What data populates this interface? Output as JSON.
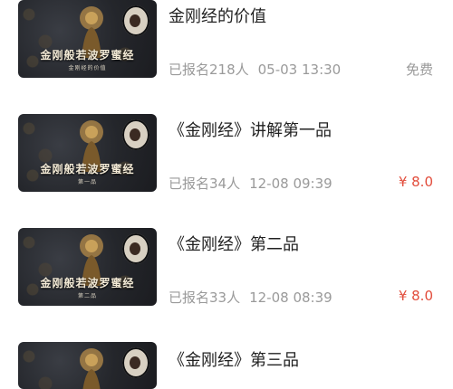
{
  "courses": [
    {
      "thumb_title": "金刚般若波罗蜜经",
      "thumb_subtitle": "金刚经的价值",
      "title": "金刚经的价值",
      "enrolled": "已报名218人",
      "datetime": "05-03 13:30",
      "price": "免费"
    },
    {
      "thumb_title": "金刚般若波罗蜜经",
      "thumb_subtitle": "第一品",
      "title": "《金刚经》讲解第一品",
      "enrolled": "已报名34人",
      "datetime": "12-08 09:39",
      "price": "¥ 8.0"
    },
    {
      "thumb_title": "金刚般若波罗蜜经",
      "thumb_subtitle": "第二品",
      "title": "《金刚经》第二品",
      "enrolled": "已报名33人",
      "datetime": "12-08 08:39",
      "price": "¥ 8.0"
    },
    {
      "thumb_title": "",
      "thumb_subtitle": "",
      "title": "《金刚经》第三品",
      "enrolled": "",
      "datetime": "",
      "price": ""
    }
  ],
  "colors": {
    "price_paid": "#e24c3b",
    "price_free": "#9a9a9a",
    "meta": "#9a9a9a",
    "title": "#222222"
  }
}
